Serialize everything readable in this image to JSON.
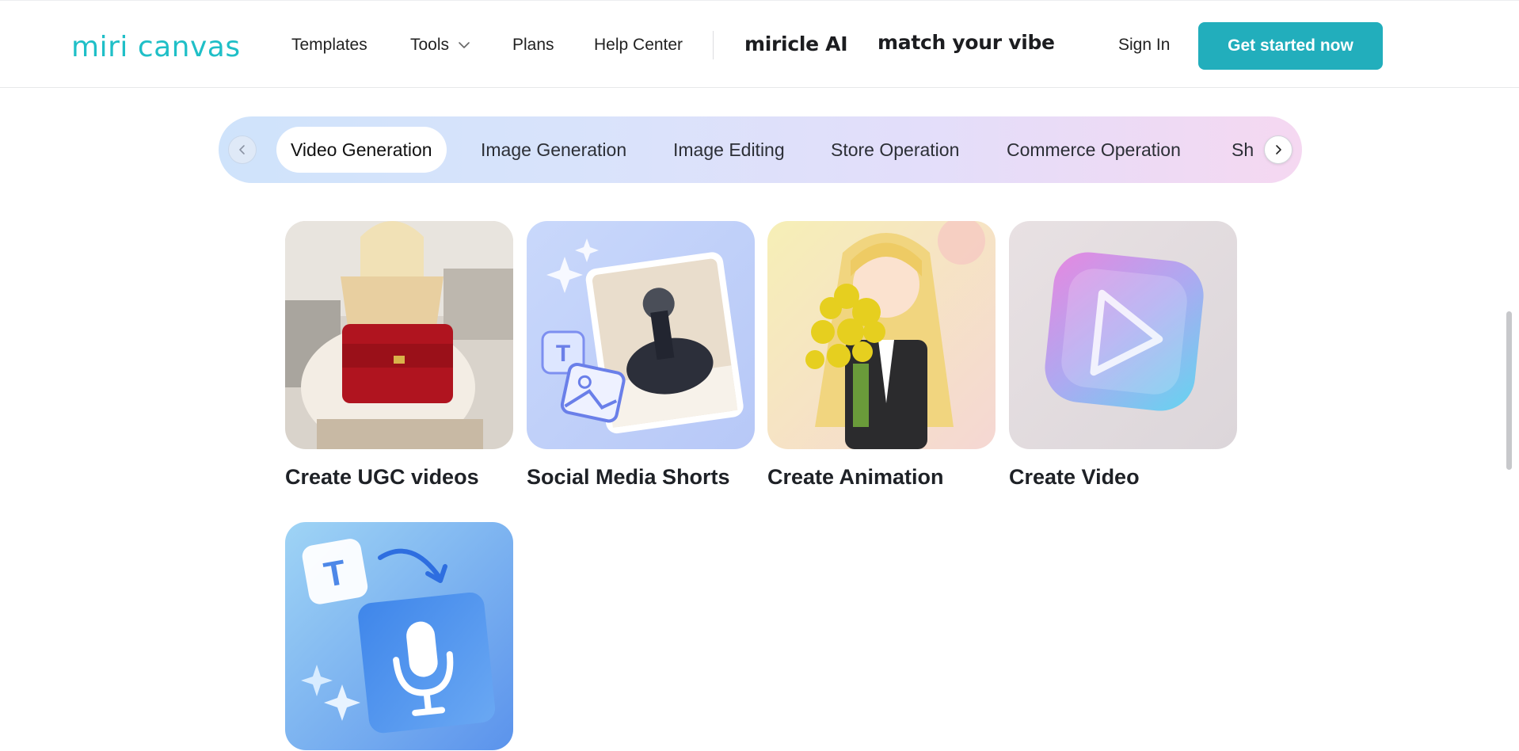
{
  "header": {
    "logo": "miri canvas",
    "nav": {
      "templates": "Templates",
      "tools": "Tools",
      "plans": "Plans",
      "help": "Help Center"
    },
    "brand1": "miricle AI",
    "brand2": "match your vibe",
    "sign_in": "Sign In",
    "cta": "Get started now"
  },
  "categories": {
    "tabs": [
      "Video Generation",
      "Image Generation",
      "Image Editing",
      "Store Operation",
      "Commerce Operation",
      "Sh"
    ],
    "active": "Video Generation"
  },
  "cards": [
    {
      "title": "Create UGC videos",
      "icon": "red-handbag-photo"
    },
    {
      "title": "Social Media Shorts",
      "icon": "dog-photo-with-text-image-icons"
    },
    {
      "title": "Create Animation",
      "icon": "anime-girl-flowers"
    },
    {
      "title": "Create Video",
      "icon": "play-button-icon"
    },
    {
      "title": "",
      "icon": "text-to-speech-microphone-icon"
    }
  ],
  "colors": {
    "accent": "#22aebc",
    "logo": "#1fbfc7"
  }
}
